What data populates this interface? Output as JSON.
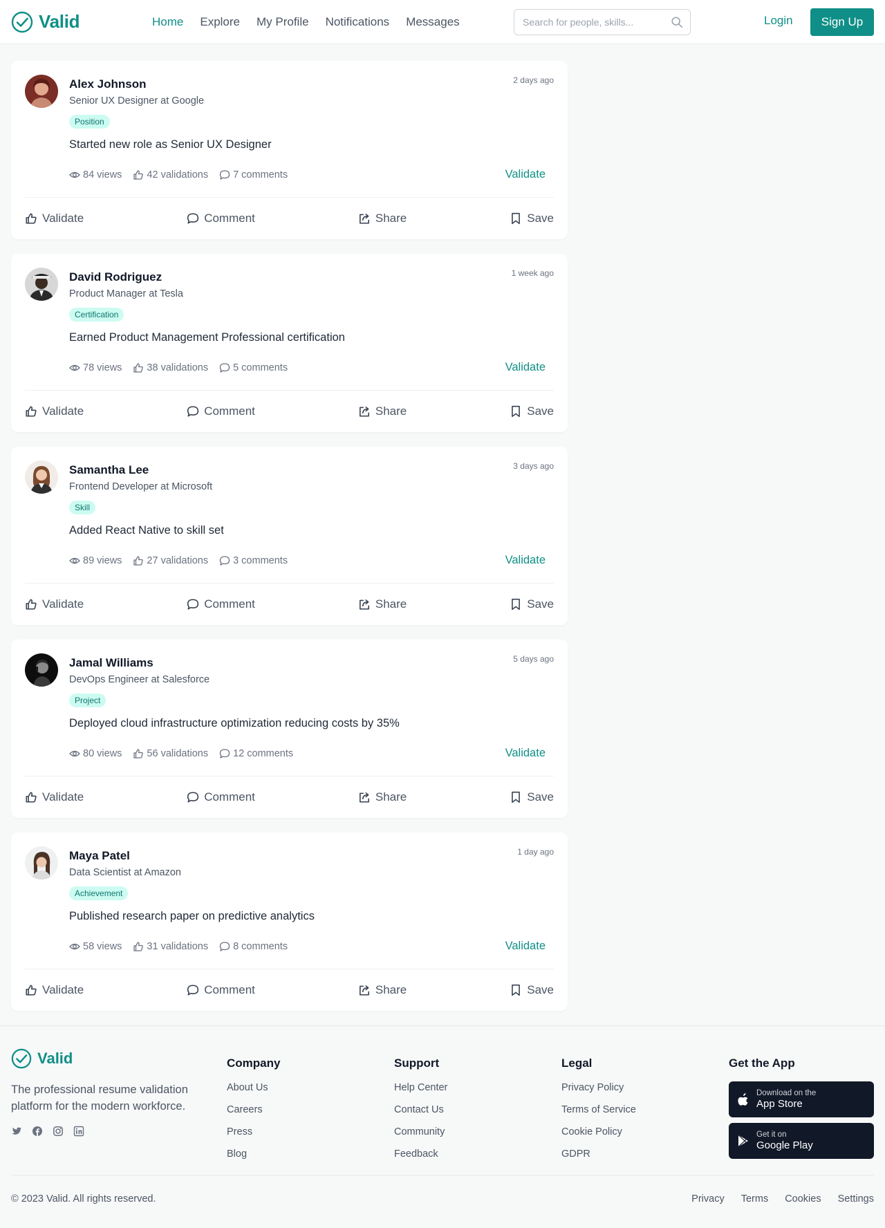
{
  "brand": {
    "name": "Valid",
    "accent": "#0f8f87"
  },
  "nav": {
    "links": [
      "Home",
      "Explore",
      "My Profile",
      "Notifications",
      "Messages"
    ],
    "active": "Home",
    "search_placeholder": "Search for people, skills...",
    "login": "Login",
    "signup": "Sign Up"
  },
  "posts": [
    {
      "name": "Alex Johnson",
      "title": "Senior UX Designer at Google",
      "tag": "Position",
      "content": "Started new role as Senior UX Designer",
      "time": "2 days ago",
      "views": "84 views",
      "validations": "42 validations",
      "comments": "7 comments"
    },
    {
      "name": "David Rodriguez",
      "title": "Product Manager at Tesla",
      "tag": "Certification",
      "content": "Earned Product Management Professional certification",
      "time": "1 week ago",
      "views": "78 views",
      "validations": "38 validations",
      "comments": "5 comments"
    },
    {
      "name": "Samantha Lee",
      "title": "Frontend Developer at Microsoft",
      "tag": "Skill",
      "content": "Added React Native to skill set",
      "time": "3 days ago",
      "views": "89 views",
      "validations": "27 validations",
      "comments": "3 comments"
    },
    {
      "name": "Jamal Williams",
      "title": "DevOps Engineer at Salesforce",
      "tag": "Project",
      "content": "Deployed cloud infrastructure optimization reducing costs by 35%",
      "time": "5 days ago",
      "views": "80 views",
      "validations": "56 validations",
      "comments": "12 comments"
    },
    {
      "name": "Maya Patel",
      "title": "Data Scientist at Amazon",
      "tag": "Achievement",
      "content": "Published research paper on predictive analytics",
      "time": "1 day ago",
      "views": "58 views",
      "validations": "31 validations",
      "comments": "8 comments"
    }
  ],
  "post_actions": {
    "validate_link": "Validate",
    "validate": "Validate",
    "comment": "Comment",
    "share": "Share",
    "save": "Save"
  },
  "footer": {
    "description": "The professional resume validation platform for the modern workforce.",
    "company": {
      "heading": "Company",
      "links": [
        "About Us",
        "Careers",
        "Press",
        "Blog"
      ]
    },
    "support": {
      "heading": "Support",
      "links": [
        "Help Center",
        "Contact Us",
        "Community",
        "Feedback"
      ]
    },
    "legal": {
      "heading": "Legal",
      "links": [
        "Privacy Policy",
        "Terms of Service",
        "Cookie Policy",
        "GDPR"
      ]
    },
    "app": {
      "heading": "Get the App",
      "appstore_small": "Download on the",
      "appstore_big": "App Store",
      "play_small": "Get it on",
      "play_big": "Google Play"
    },
    "copyright": "© 2023 Valid. All rights reserved.",
    "bottom_links": [
      "Privacy",
      "Terms",
      "Cookies",
      "Settings"
    ]
  }
}
